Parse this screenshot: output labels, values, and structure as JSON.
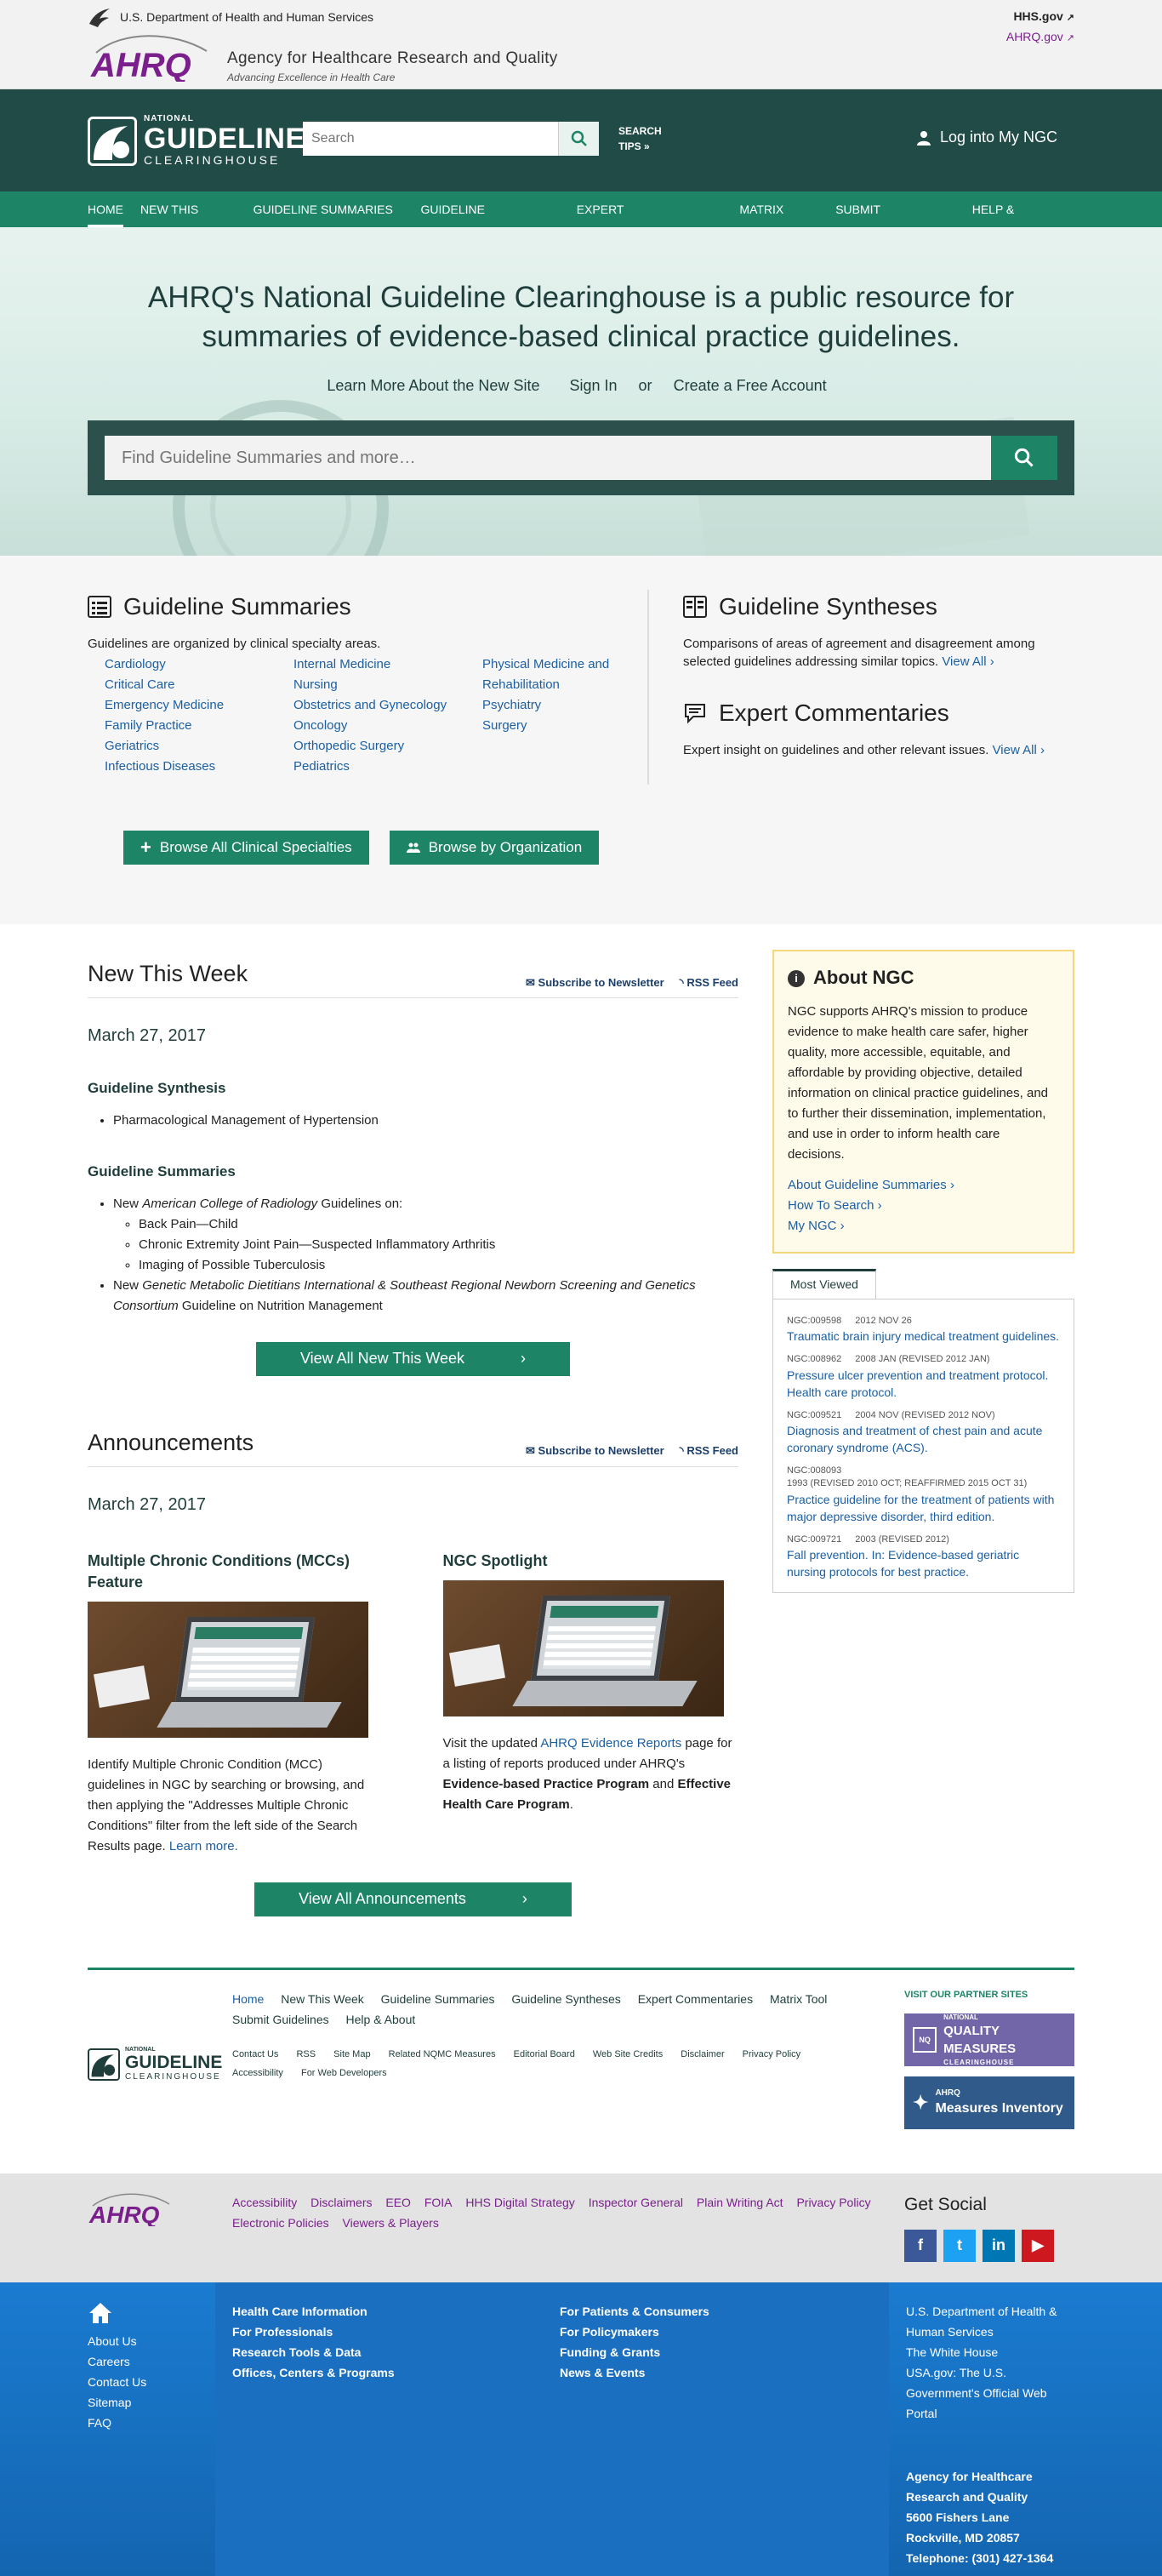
{
  "hhs": {
    "dept": "U.S. Department of Health and Human Services",
    "hhs_link": "HHS.gov",
    "ahrq_link": "AHRQ.gov"
  },
  "ahrq": {
    "logo_text": "AHRQ",
    "name": "Agency for Healthcare Research and Quality",
    "tagline": "Advancing Excellence in Health Care"
  },
  "ngc": {
    "logo_national": "NATIONAL",
    "logo_guideline": "GUIDELINE",
    "logo_clearinghouse": "CLEARINGHOUSE",
    "search_placeholder": "Search",
    "search_tips": "SEARCH",
    "search_tips2": "TIPS »",
    "login": "Log into My NGC"
  },
  "nav": [
    "HOME",
    "NEW THIS WEEK",
    "GUIDELINE SUMMARIES",
    "GUIDELINE SYNTHESES",
    "EXPERT COMMENTARIES",
    "MATRIX TOOL",
    "SUBMIT GUIDELINES",
    "HELP & ABOUT"
  ],
  "hero": {
    "headline": "AHRQ's National Guideline Clearinghouse is a public resource for summaries of evidence-based clinical practice guidelines.",
    "link1": "Learn More About the New Site",
    "link2_a": "Sign In",
    "link2_b": "or",
    "link2_c": "Create a Free Account",
    "search_placeholder": "Find Guideline Summaries and more…"
  },
  "summaries": {
    "title": "Guideline Summaries",
    "desc": "Guidelines are organized by clinical specialty areas.",
    "col1": [
      "Cardiology",
      "Critical Care",
      "Emergency Medicine",
      "Family Practice",
      "Geriatrics",
      "Infectious Diseases"
    ],
    "col2": [
      "Internal Medicine",
      "Nursing",
      "Obstetrics and Gynecology",
      "Oncology",
      "Orthopedic Surgery",
      "Pediatrics"
    ],
    "col3": [
      "Physical Medicine and Rehabilitation",
      "Psychiatry",
      "Surgery"
    ]
  },
  "syntheses": {
    "title": "Guideline Syntheses",
    "desc": "Comparisons of areas of agreement and disagreement among selected guidelines addressing similar topics.",
    "link": "View All"
  },
  "commentaries": {
    "title": "Expert Commentaries",
    "desc": "Expert insight on guidelines and other relevant issues.",
    "link": "View All"
  },
  "browse": {
    "btn1": "Browse All Clinical Specialties",
    "btn2": "Browse by Organization"
  },
  "new_week": {
    "title": "New This Week",
    "subscribe": "Subscribe to Newsletter",
    "rss": "RSS Feed",
    "date": "March 27, 2017",
    "synth_head": "Guideline Synthesis",
    "synth_item": "Pharmacological Management of Hypertension",
    "sum_head": "Guideline Summaries",
    "item1_pre": "New",
    "item1_org": "American College of Radiology",
    "item1_post": "Guidelines on:",
    "item1_subs": [
      "Back Pain—Child",
      "Chronic Extremity Joint Pain—Suspected Inflammatory Arthritis",
      "Imaging of Possible Tuberculosis"
    ],
    "item2_pre": "New",
    "item2_org": "Genetic Metabolic Dietitians International & Southeast Regional Newborn Screening and Genetics Consortium",
    "item2_post": "Guideline on Nutrition Management",
    "btn": "View All New This Week"
  },
  "announcements": {
    "title": "Announcements",
    "subscribe": "Subscribe to Newsletter",
    "rss": "RSS Feed",
    "date": "March 27, 2017",
    "a1_title": "Multiple Chronic Conditions (MCCs) Feature",
    "a1_text": "Identify Multiple Chronic Condition (MCC) guidelines in NGC by searching or browsing, and then applying the \"Addresses Multiple Chronic Conditions\" filter from the left side of the Search Results page.",
    "a1_link": "Learn more.",
    "a2_title": "NGC Spotlight",
    "a2_pre": "Visit the updated",
    "a2_link": "AHRQ Evidence Reports",
    "a2_mid": "page for a listing of reports produced under AHRQ's",
    "a2_b1": "Evidence-based Practice Program",
    "a2_and": "and",
    "a2_b2": "Effective Health Care Program",
    "btn": "View All Announcements"
  },
  "about": {
    "title": "About NGC",
    "text": "NGC supports AHRQ's mission to produce evidence to make health care safer, higher quality, more accessible, equitable, and affordable by providing objective, detailed information on clinical practice guidelines, and to further their dissemination, implementation, and use in order to inform health care decisions.",
    "links": [
      "About Guideline Summaries",
      "How To Search",
      "My NGC"
    ]
  },
  "most_viewed": {
    "tab": "Most Viewed",
    "items": [
      {
        "id": "NGC:009598",
        "date": "2012 NOV 26",
        "title": "Traumatic brain injury medical treatment guidelines."
      },
      {
        "id": "NGC:008962",
        "date": "2008 JAN (REVISED 2012 JAN)",
        "title": "Pressure ulcer prevention and treatment protocol. Health care protocol."
      },
      {
        "id": "NGC:009521",
        "date": "2004 NOV (REVISED 2012 NOV)",
        "title": "Diagnosis and treatment of chest pain and acute coronary syndrome (ACS)."
      },
      {
        "id": "NGC:008093",
        "date": "1993 (REVISED 2010 OCT; REAFFIRMED 2015 OCT 31)",
        "title": "Practice guideline for the treatment of patients with major depressive disorder, third edition."
      },
      {
        "id": "NGC:009721",
        "date": "2003 (REVISED 2012)",
        "title": "Fall prevention. In: Evidence-based geriatric nursing protocols for best practice."
      }
    ]
  },
  "footer1": {
    "nav": [
      "Home",
      "New This Week",
      "Guideline Summaries",
      "Guideline Syntheses",
      "Expert Commentaries",
      "Matrix Tool",
      "Submit Guidelines",
      "Help & About"
    ],
    "sub": [
      "Contact Us",
      "RSS",
      "Site Map",
      "Related NQMC Measures",
      "Editorial Board",
      "Web Site Credits",
      "Disclaimer",
      "Privacy Policy",
      "Accessibility",
      "For Web Developers"
    ],
    "partner_label": "VISIT OUR PARTNER SITES",
    "partner1_small": "NATIONAL",
    "partner1": "QUALITY MEASURES",
    "partner1_sub": "CLEARINGHOUSE",
    "partner2_small": "AHRQ",
    "partner2": "Measures Inventory"
  },
  "footer2": {
    "logo": "AHRQ",
    "links": [
      "Accessibility",
      "Disclaimers",
      "EEO",
      "FOIA",
      "HHS Digital Strategy",
      "Inspector General",
      "Plain Writing Act",
      "Privacy Policy",
      "Electronic Policies",
      "Viewers & Players"
    ],
    "social": "Get Social"
  },
  "footer3": {
    "col1": [
      "About Us",
      "Careers",
      "Contact Us",
      "Sitemap",
      "FAQ"
    ],
    "col2": [
      "Health Care Information",
      "For Professionals",
      "Research Tools & Data",
      "Offices, Centers & Programs"
    ],
    "col3": [
      "For Patients & Consumers",
      "For Policymakers",
      "Funding & Grants",
      "News & Events"
    ],
    "col4": [
      "U.S. Department of Health & Human Services",
      "The White House",
      "USA.gov: The U.S. Government's Official Web Portal"
    ],
    "address": [
      "Agency for Healthcare Research and Quality",
      "5600 Fishers Lane",
      "Rockville, MD 20857",
      "Telephone: (301) 427-1364"
    ]
  },
  "colors": {
    "dark_green": "#214b46",
    "nav_green": "#1d8466",
    "ahrq_purple": "#7a1f8c",
    "link_blue": "#1b5fa3",
    "footer_blue": "#1a7bd0"
  }
}
